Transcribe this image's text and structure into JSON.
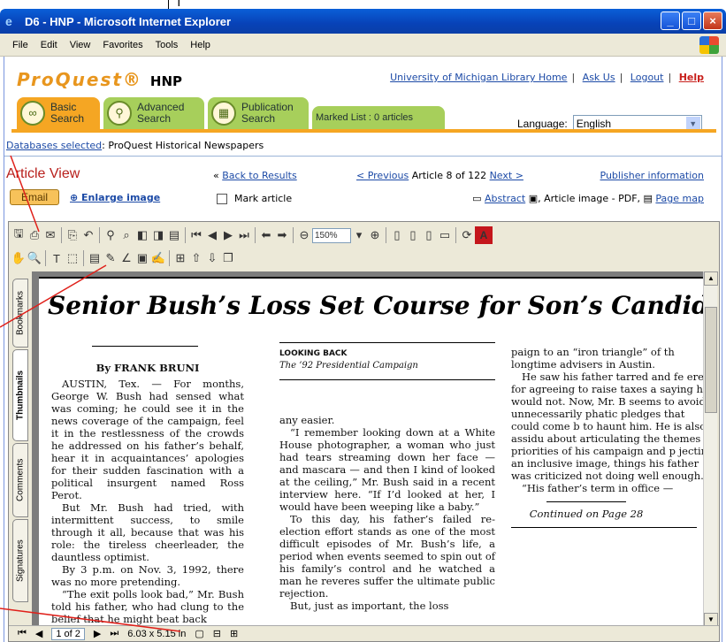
{
  "window": {
    "title": "D6 - HNP - Microsoft Internet Explorer",
    "stray_text": "T"
  },
  "menu": [
    "File",
    "Edit",
    "View",
    "Favorites",
    "Tools",
    "Help"
  ],
  "header": {
    "logo_text": "ProQuest",
    "logo_suffix": "HNP",
    "links": [
      "University of Michigan Library Home",
      "Ask Us",
      "Logout"
    ],
    "help": "Help"
  },
  "tabs": {
    "basic": {
      "line1": "Basic",
      "line2": "Search"
    },
    "advanced": {
      "line1": "Advanced",
      "line2": "Search"
    },
    "publication": {
      "line1": "Publication",
      "line2": "Search"
    },
    "marked": "Marked List : 0 articles"
  },
  "language": {
    "label": "Language:",
    "value": "English"
  },
  "databases": {
    "label": "Databases selected",
    "value": ": ProQuest Historical Newspapers"
  },
  "article": {
    "heading": "Article View",
    "back": "Back to Results",
    "previous": "< Previous",
    "position": "Article 8 of 122",
    "next": "Next >",
    "publisher": "Publisher information",
    "email": "Email",
    "enlarge": "Enlarge image",
    "mark": "Mark article",
    "abstract": "Abstract",
    "image_pdf": ", Article image - PDF,",
    "page_map": "Page map"
  },
  "viewer": {
    "zoom": "150%",
    "sidetabs": [
      "Bookmarks",
      "Thumbnails",
      "Comments",
      "Signatures"
    ],
    "page_indicator": "1 of 2",
    "page_size": "6.03 x 5.15 in"
  },
  "document": {
    "headline": "Senior Bush’s Loss Set Course for Son’s Candidac",
    "byline": "By FRANK BRUNI",
    "col1": [
      "AUSTIN, Tex. — For months, George W. Bush had sensed what was coming; he could see it in the news coverage of the campaign, feel it in the restlessness of the crowds he addressed on his father’s behalf, hear it in acquaintances’ apologies for their sudden fascination with a political insurgent named Ross Perot.",
      "But Mr. Bush had tried, with intermittent success, to smile through it all, because that was his role: the tireless cheerleader, the dauntless optimist.",
      "By 3 p.m. on Nov. 3, 1992, there was no more pretending.",
      "“The exit polls look bad,” Mr. Bush told his father, who had clung to the belief that he might beat back"
    ],
    "box_title": "LOOKING BACK",
    "box_subtitle": "The ’92 Presidential Campaign",
    "col2": [
      "any easier.",
      "“I remember looking down at a White House photographer, a woman who just had tears streaming down her face — and mascara — and then I kind of looked at the ceiling,” Mr. Bush said in a recent interview here. “If I’d looked at her, I would have been weeping like a baby.”",
      "To this day, his father’s failed re-election effort stands as one of the most difficult episodes of Mr. Bush’s life, a period when events seemed to spin out of his family’s control and he watched a man he reveres suffer the ultimate public rejection.",
      "But, just as important, the loss"
    ],
    "col3": [
      "paign to an “iron triangle” of th longtime advisers in Austin.",
      "He saw his father tarred and fe ered for agreeing to raise taxes a saying he would not. Now, Mr. B seems to avoid unnecessarily phatic pledges that could come b to haunt him. He is also assidu about articulating the themes priorities of his campaign and p jecting an inclusive image, things his father was criticized not doing well enough.",
      "“His father’s term in office —"
    ],
    "continued": "Continued on Page 28"
  },
  "colors": {
    "annotation": "#e0201a",
    "tab_active": "#f5a623",
    "tab_inactive": "#a7cf5b",
    "link": "#1c4aa6"
  }
}
